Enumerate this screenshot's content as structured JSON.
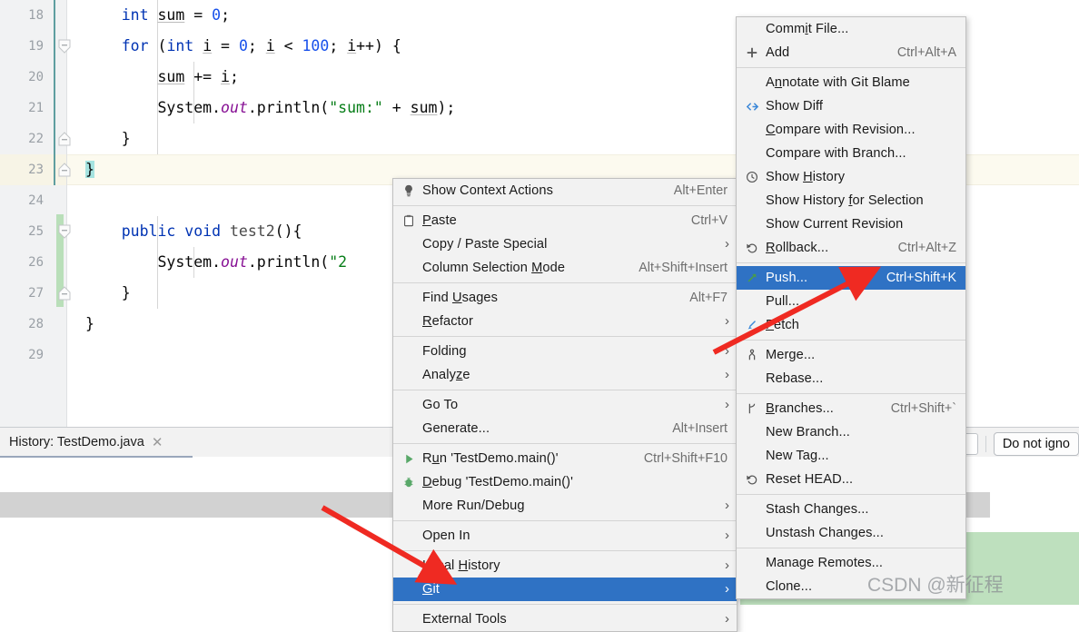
{
  "editor": {
    "line_numbers": [
      "18",
      "19",
      "20",
      "21",
      "22",
      "23",
      "24",
      "25",
      "26",
      "27",
      "28",
      "29"
    ],
    "code_lines": [
      {
        "n": "18",
        "text": "    int sum = 0;"
      },
      {
        "n": "19",
        "text": "    for (int i = 0; i < 100; i++) {"
      },
      {
        "n": "20",
        "text": "        sum += i;"
      },
      {
        "n": "21",
        "text": "        System.out.println(\"sum:\" + sum);"
      },
      {
        "n": "22",
        "text": "    }"
      },
      {
        "n": "23",
        "text": "}"
      },
      {
        "n": "24",
        "text": ""
      },
      {
        "n": "25",
        "text": "    public void test2(){"
      },
      {
        "n": "26",
        "text": "        System.out.println(\"2"
      },
      {
        "n": "27",
        "text": "    }"
      },
      {
        "n": "28",
        "text": "}"
      },
      {
        "n": "29",
        "text": ""
      }
    ],
    "tokens": {
      "kw_int": "int",
      "kw_for": "for",
      "kw_public": "public",
      "kw_void": "void",
      "var_sum": "sum",
      "var_i": "i",
      "zero": "0",
      "hundred": "100",
      "system": "System",
      "out": "out",
      "println": "println",
      "str_sum": "\"sum:\"",
      "str_two": "\"2",
      "method_test2": "test2"
    }
  },
  "bottom_panel": {
    "tab": {
      "label": "History: TestDemo.java",
      "close_icon": "close-icon"
    },
    "toolbar": {
      "ignore_button": "Do not igno"
    }
  },
  "context_menu": {
    "items": [
      {
        "label": "Show Context Actions",
        "accel": "Alt+Enter",
        "icon": "lightbulb-icon",
        "submenu": false,
        "mnemonic": ""
      },
      {
        "sep": true
      },
      {
        "label": "Paste",
        "accel": "Ctrl+V",
        "icon": "clipboard-icon",
        "submenu": false,
        "mnemonic": "P"
      },
      {
        "label": "Copy / Paste Special",
        "accel": "",
        "icon": "",
        "submenu": true,
        "mnemonic": ""
      },
      {
        "label": "Column Selection Mode",
        "accel": "Alt+Shift+Insert",
        "icon": "",
        "submenu": false,
        "mnemonic": "M"
      },
      {
        "sep": true
      },
      {
        "label": "Find Usages",
        "accel": "Alt+F7",
        "icon": "",
        "submenu": false,
        "mnemonic": "U"
      },
      {
        "label": "Refactor",
        "accel": "",
        "icon": "",
        "submenu": true,
        "mnemonic": "R"
      },
      {
        "sep": true
      },
      {
        "label": "Folding",
        "accel": "",
        "icon": "",
        "submenu": true,
        "mnemonic": ""
      },
      {
        "label": "Analyze",
        "accel": "",
        "icon": "",
        "submenu": true,
        "mnemonic": "z"
      },
      {
        "sep": true
      },
      {
        "label": "Go To",
        "accel": "",
        "icon": "",
        "submenu": true,
        "mnemonic": ""
      },
      {
        "label": "Generate...",
        "accel": "Alt+Insert",
        "icon": "",
        "submenu": false,
        "mnemonic": ""
      },
      {
        "sep": true
      },
      {
        "label": "Run 'TestDemo.main()'",
        "accel": "Ctrl+Shift+F10",
        "icon": "run-icon",
        "submenu": false,
        "mnemonic": "u"
      },
      {
        "label": "Debug 'TestDemo.main()'",
        "accel": "",
        "icon": "debug-icon",
        "submenu": false,
        "mnemonic": "D"
      },
      {
        "label": "More Run/Debug",
        "accel": "",
        "icon": "",
        "submenu": true,
        "mnemonic": ""
      },
      {
        "sep": true
      },
      {
        "label": "Open In",
        "accel": "",
        "icon": "",
        "submenu": true,
        "mnemonic": ""
      },
      {
        "sep": true
      },
      {
        "label": "Local History",
        "accel": "",
        "icon": "",
        "submenu": true,
        "mnemonic": "H"
      },
      {
        "label": "Git",
        "accel": "",
        "icon": "",
        "submenu": true,
        "mnemonic": "G",
        "selected": true
      },
      {
        "sep": true
      },
      {
        "label": "External Tools",
        "accel": "",
        "icon": "",
        "submenu": true,
        "mnemonic": ""
      }
    ]
  },
  "git_submenu": {
    "items": [
      {
        "label": "Commit File...",
        "accel": "",
        "icon": "",
        "submenu": false,
        "mnemonic": "i"
      },
      {
        "label": "Add",
        "accel": "Ctrl+Alt+A",
        "icon": "plus-icon",
        "submenu": false,
        "mnemonic": ""
      },
      {
        "sep": true
      },
      {
        "label": "Annotate with Git Blame",
        "accel": "",
        "icon": "",
        "submenu": false,
        "mnemonic": "n"
      },
      {
        "label": "Show Diff",
        "accel": "",
        "icon": "diff-icon",
        "submenu": false,
        "mnemonic": ""
      },
      {
        "label": "Compare with Revision...",
        "accel": "",
        "icon": "",
        "submenu": false,
        "mnemonic": "C"
      },
      {
        "label": "Compare with Branch...",
        "accel": "",
        "icon": "",
        "submenu": false,
        "mnemonic": ""
      },
      {
        "label": "Show History",
        "accel": "",
        "icon": "clock-icon",
        "submenu": false,
        "mnemonic": "H"
      },
      {
        "label": "Show History for Selection",
        "accel": "",
        "icon": "",
        "submenu": false,
        "mnemonic": "f"
      },
      {
        "label": "Show Current Revision",
        "accel": "",
        "icon": "",
        "submenu": false,
        "mnemonic": ""
      },
      {
        "label": "Rollback...",
        "accel": "Ctrl+Alt+Z",
        "icon": "rollback-icon",
        "submenu": false,
        "mnemonic": "R"
      },
      {
        "sep": true
      },
      {
        "label": "Push...",
        "accel": "Ctrl+Shift+K",
        "icon": "push-icon",
        "submenu": false,
        "mnemonic": "",
        "selected": true
      },
      {
        "label": "Pull...",
        "accel": "",
        "icon": "",
        "submenu": false,
        "mnemonic": ""
      },
      {
        "label": "Fetch",
        "accel": "",
        "icon": "fetch-icon",
        "submenu": false,
        "mnemonic": "F"
      },
      {
        "sep": true
      },
      {
        "label": "Merge...",
        "accel": "",
        "icon": "merge-icon",
        "submenu": false,
        "mnemonic": ""
      },
      {
        "label": "Rebase...",
        "accel": "",
        "icon": "",
        "submenu": false,
        "mnemonic": ""
      },
      {
        "sep": true
      },
      {
        "label": "Branches...",
        "accel": "Ctrl+Shift+`",
        "icon": "branch-icon",
        "submenu": false,
        "mnemonic": "B"
      },
      {
        "label": "New Branch...",
        "accel": "",
        "icon": "",
        "submenu": false,
        "mnemonic": ""
      },
      {
        "label": "New Tag...",
        "accel": "",
        "icon": "",
        "submenu": false,
        "mnemonic": ""
      },
      {
        "label": "Reset HEAD...",
        "accel": "",
        "icon": "reset-icon",
        "submenu": false,
        "mnemonic": ""
      },
      {
        "sep": true
      },
      {
        "label": "Stash Changes...",
        "accel": "",
        "icon": "",
        "submenu": false,
        "mnemonic": ""
      },
      {
        "label": "Unstash Changes...",
        "accel": "",
        "icon": "",
        "submenu": false,
        "mnemonic": ""
      },
      {
        "sep": true
      },
      {
        "label": "Manage Remotes...",
        "accel": "",
        "icon": "",
        "submenu": false,
        "mnemonic": ""
      },
      {
        "label": "Clone...",
        "accel": "",
        "icon": "",
        "submenu": false,
        "mnemonic": ""
      }
    ]
  },
  "watermark": {
    "text": "CSDN @新征程"
  },
  "ghost_line_number": "25",
  "colors": {
    "menu_bg": "#f2f2f2",
    "menu_selected": "#2f72c4",
    "annotation_arrow": "#ef2a22",
    "keyword": "#0033b3",
    "number": "#1750eb",
    "string": "#067d17",
    "field": "#871094",
    "caret_line": "#fcfaef",
    "selection": "#a5e3e0",
    "diff_added": "#bee0be"
  }
}
